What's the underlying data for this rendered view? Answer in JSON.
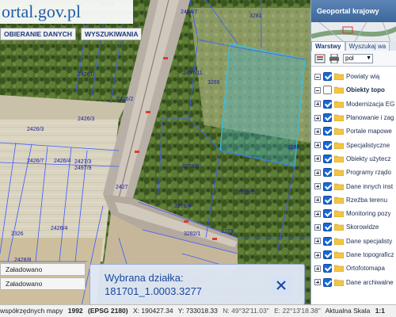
{
  "header": {
    "logo_text": "ortal.gov.pl",
    "menu": [
      "OBIERANIE DANYCH",
      "WYSZUKIWANIA"
    ]
  },
  "map": {
    "parcel_labels": [
      "2494/7",
      "2427/",
      "24261/",
      "2426/2",
      "2426/3",
      "2426/4",
      "2426/4",
      "2427",
      "2428/8",
      "2428/10",
      "2427/3",
      "2497/9",
      "2497/11",
      "2426/3",
      "2426/7",
      "3286",
      "3278/6",
      "3278/2",
      "3282/1",
      "3279",
      "3280",
      "2326",
      "3281",
      "3276/4"
    ]
  },
  "panel": {
    "title": "Geoportal krajowy",
    "tabs": [
      "Warstwy",
      "Wyszukaj wa"
    ],
    "language": "pol",
    "layers": [
      {
        "label": "Powiaty wią",
        "checked": true,
        "expander": "minus",
        "bold": false
      },
      {
        "label": "Obiekty topo",
        "checked": false,
        "expander": "minus",
        "bold": true
      },
      {
        "label": "Modernizacja EG",
        "checked": true,
        "expander": "plus",
        "bold": false
      },
      {
        "label": "Planowanie i zag",
        "checked": true,
        "expander": "plus",
        "bold": false
      },
      {
        "label": "Portale mapowe",
        "checked": true,
        "expander": "plus",
        "bold": false
      },
      {
        "label": "Specjalistyczne",
        "checked": true,
        "expander": "plus",
        "bold": false
      },
      {
        "label": "Obiekty użytecz",
        "checked": true,
        "expander": "plus",
        "bold": false
      },
      {
        "label": "Programy rządo",
        "checked": true,
        "expander": "plus",
        "bold": false
      },
      {
        "label": "Dane innych inst",
        "checked": true,
        "expander": "plus",
        "bold": false
      },
      {
        "label": "Rzeźba terenu",
        "checked": true,
        "expander": "plus",
        "bold": false
      },
      {
        "label": "Monitoring pozy",
        "checked": true,
        "expander": "plus",
        "bold": false
      },
      {
        "label": "Skorowidze",
        "checked": true,
        "expander": "plus",
        "bold": false
      },
      {
        "label": "Dane specjalisty",
        "checked": true,
        "expander": "plus",
        "bold": false
      },
      {
        "label": "Dane topograficz",
        "checked": true,
        "expander": "plus",
        "bold": false
      },
      {
        "label": "Ortofotomapa",
        "checked": true,
        "expander": "plus",
        "bold": false
      },
      {
        "label": "Dane archiwalne",
        "checked": true,
        "expander": "plus",
        "bold": false
      }
    ]
  },
  "bottom": {
    "loaded_1": "Załadowano",
    "loaded_2": "Załadowano"
  },
  "popup": {
    "title": "Wybrana działka:",
    "value": "181701_1.0003.3277"
  },
  "status": {
    "prefix": "współrzędnych mapy",
    "system": "1992",
    "epsg": "(EPSG 2180)",
    "x": "X: 190427.34",
    "y": "Y: 733018.33",
    "n": "N: 49°32'11.03\"",
    "e": "E: 22°13'18.38\"",
    "scale_label": "Aktualna Skala",
    "scale_value": "1:1"
  },
  "colors": {
    "accent": "#1f5da8",
    "parcel_lines": "#3a5bff",
    "highlight": "#35c0e8"
  }
}
